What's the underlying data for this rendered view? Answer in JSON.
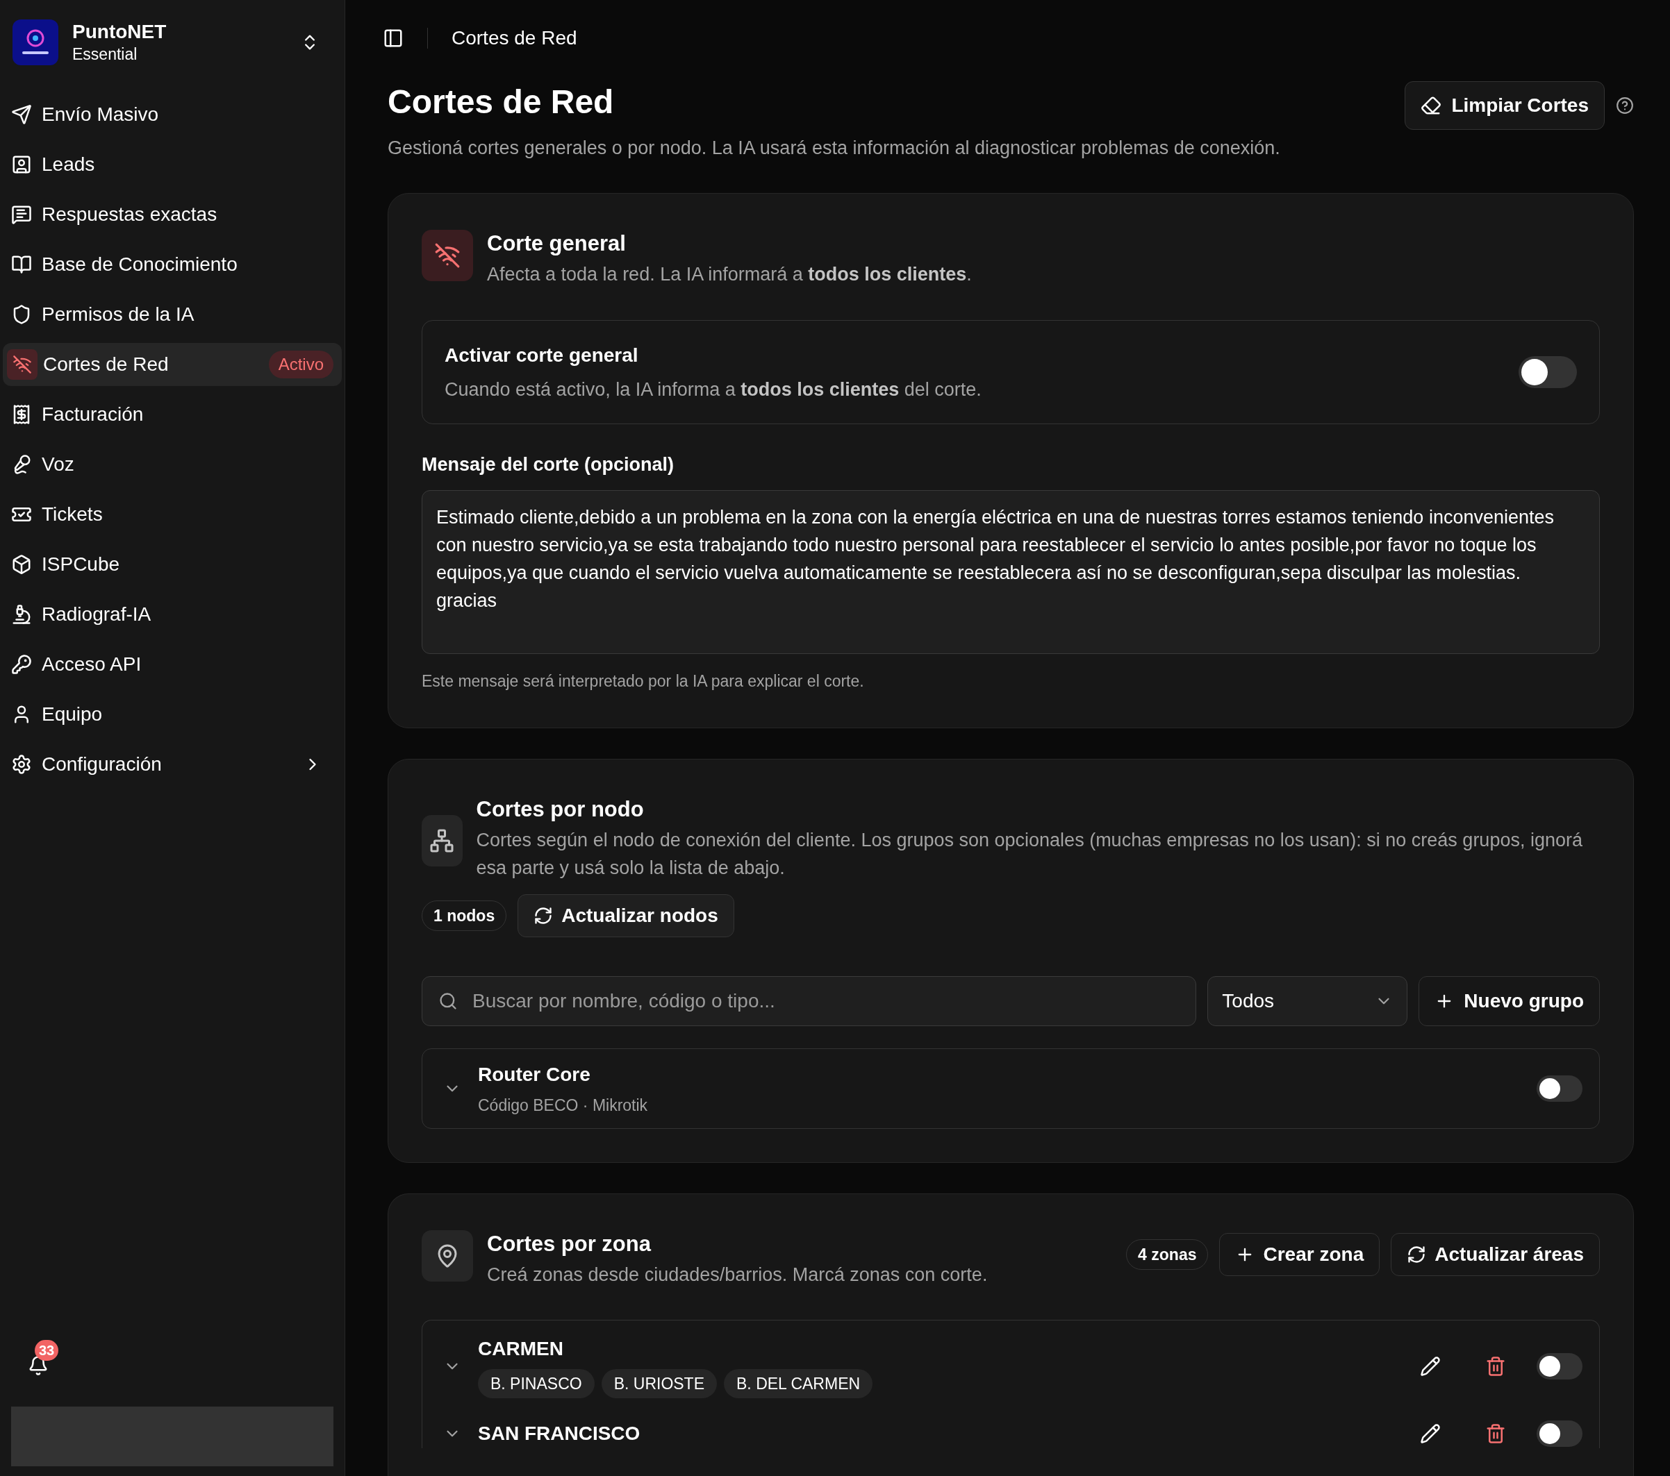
{
  "sidebar": {
    "brand": {
      "name": "PuntoNET",
      "plan": "Essential"
    },
    "items": [
      {
        "label": "Envío Masivo",
        "selected": false
      },
      {
        "label": "Leads",
        "selected": false
      },
      {
        "label": "Respuestas exactas",
        "selected": false
      },
      {
        "label": "Base de Conocimiento",
        "selected": false
      },
      {
        "label": "Permisos de la IA",
        "selected": false
      },
      {
        "label": "Cortes de Red",
        "selected": true,
        "badge": "Activo"
      },
      {
        "label": "Facturación",
        "selected": false
      },
      {
        "label": "Voz",
        "selected": false
      },
      {
        "label": "Tickets",
        "selected": false
      },
      {
        "label": "ISPCube",
        "selected": false
      },
      {
        "label": "Radiograf-IA",
        "selected": false
      },
      {
        "label": "Acceso API",
        "selected": false
      },
      {
        "label": "Equipo",
        "selected": false
      },
      {
        "label": "Configuración",
        "selected": false,
        "expandable": true
      }
    ],
    "notifications": {
      "count": "33"
    }
  },
  "header": {
    "breadcrumb": "Cortes de Red"
  },
  "page": {
    "title": "Cortes de Red",
    "subtitle": "Gestioná cortes generales o por nodo. La IA usará esta información al diagnosticar problemas de conexión.",
    "clear_button": "Limpiar Cortes"
  },
  "general": {
    "title": "Corte general",
    "description": "Afecta a toda la red. La IA informará a **todos los clientes**.",
    "toggle": {
      "title": "Activar corte general",
      "description": "Cuando está activo, la IA informa a **todos los clientes** del corte.",
      "on": false
    },
    "message_label": "Mensaje del corte (opcional)",
    "message_value": "Estimado cliente,debido a un problema en la zona con la energía eléctrica en una de nuestras torres estamos teniendo inconvenientes con nuestro servicio,ya se esta trabajando todo nuestro personal para reestablecer el servicio lo antes posible,por favor no toque los equipos,ya que cuando el servicio vuelva automaticamente se reestablecera así no se desconfiguran,sepa disculpar las molestias. gracias",
    "message_hint": "Este mensaje será interpretado por la IA para explicar el corte."
  },
  "nodes": {
    "title": "Cortes por nodo",
    "description": "Cortes según el nodo de conexión del cliente. Los grupos son opcionales (muchas empresas no los usan): si no creás grupos, ignorá esa parte y usá solo la lista de abajo.",
    "count": "1 nodos",
    "refresh_button": "Actualizar nodos",
    "search_placeholder": "Buscar por nombre, código o tipo...",
    "filter": "Todos",
    "new_group_button": "Nuevo grupo",
    "items": [
      {
        "name": "Router Core",
        "detail": "Código BECO · Mikrotik",
        "on": false
      }
    ]
  },
  "zones": {
    "title": "Cortes por zona",
    "description": "Creá zonas desde ciudades/barrios. Marcá zonas con corte.",
    "count": "4 zonas",
    "create_button": "Crear zona",
    "refresh_button": "Actualizar áreas",
    "items": [
      {
        "name": "CARMEN",
        "tags": [
          "B. PINASCO",
          "B. URIOSTE",
          "B. DEL CARMEN"
        ],
        "on": false
      },
      {
        "name": "SAN FRANCISCO",
        "on": false
      }
    ]
  }
}
